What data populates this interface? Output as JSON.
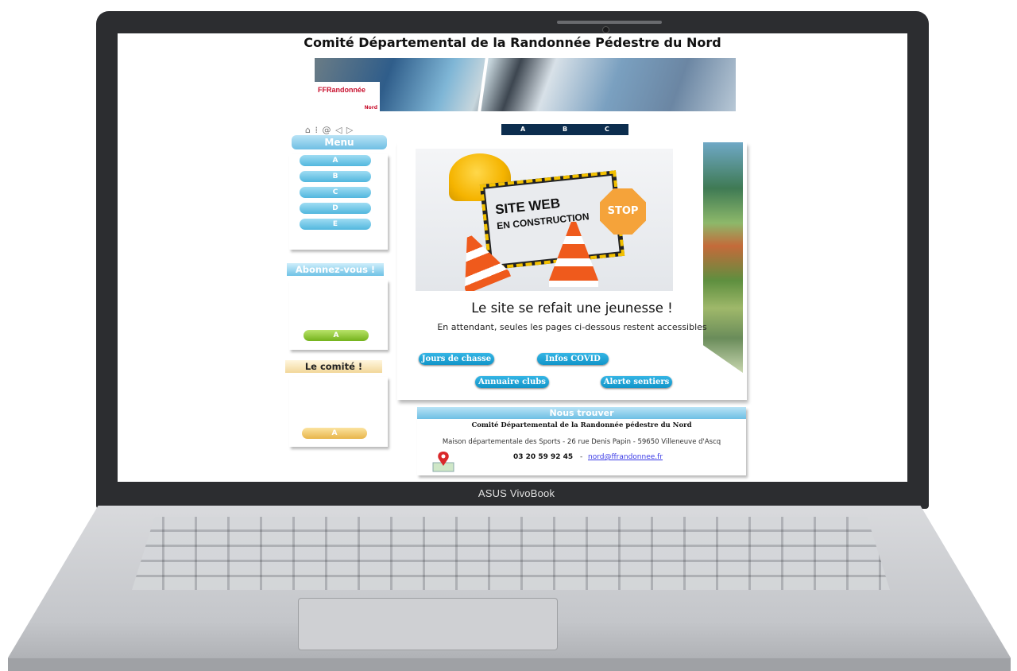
{
  "laptop": {
    "brand": "ASUS VivoBook"
  },
  "site": {
    "title": "Comité Départemental de la Randonnée Pédestre du Nord",
    "banner_logo": "FFRandonnée",
    "banner_logo_sub": "Nord",
    "mini_nav_icons": [
      "home-icon",
      "info-icon",
      "at-icon",
      "back-icon",
      "forward-icon"
    ],
    "mini_nav_text": "⌂ ⁞ @ ◁ ▷",
    "top_nav": [
      "A",
      "B",
      "C"
    ],
    "menu": {
      "title": "Menu",
      "items": [
        "A",
        "B",
        "C",
        "D",
        "E"
      ]
    },
    "abonnez": {
      "title": "Abonnez-vous !",
      "button": "A"
    },
    "comite": {
      "title": "Le comité !",
      "button": "A"
    },
    "construction": {
      "line1": "SITE WEB",
      "line2": "EN CONSTRUCTION",
      "stop": "STOP"
    },
    "headline": "Le site se refait une jeunesse !",
    "subline": "En attendant, seules les pages ci-dessous restent accessibles",
    "buttons": [
      "Jours de chasse",
      "Infos COVID",
      "Annuaire clubs",
      "Alerte sentiers"
    ],
    "nous_trouver": {
      "title": "Nous trouver",
      "org": "Comité Départemental de la Randonnée pédestre du Nord",
      "address": "Maison départementale des Sports - 26 rue Denis Papin - 59650 Villeneuve d'Ascq",
      "phone": "03 20 59 92 45",
      "separator": "-",
      "email": "nord@ffrandonnee.fr"
    }
  },
  "colors": {
    "accent_blue": "#1094c8",
    "nav_dark": "#0c2d4e",
    "green": "#74b21c",
    "gold": "#e8b54a"
  }
}
